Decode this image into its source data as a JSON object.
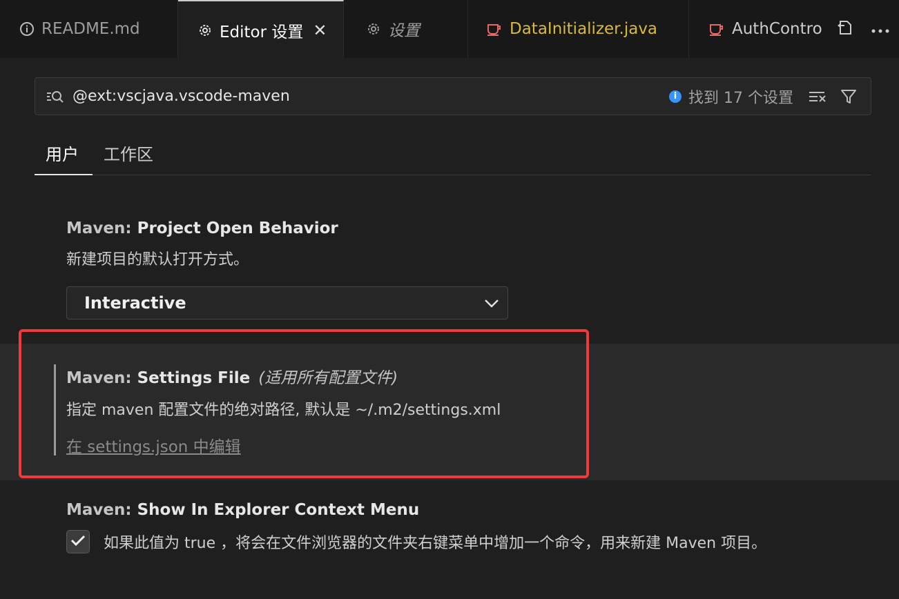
{
  "tabs": [
    {
      "label": "README.md",
      "icon": "info-icon"
    },
    {
      "label": "Editor 设置",
      "icon": "gear-icon",
      "close": "✕"
    },
    {
      "label": "设置",
      "icon": "gear-icon"
    },
    {
      "label": "DataInitializer.java",
      "icon": "java-icon"
    },
    {
      "label": "AuthContro",
      "icon": "java-icon"
    }
  ],
  "search": {
    "value": "@ext:vscjava.vscode-maven",
    "result_count": "找到 17 个设置"
  },
  "scope_tabs": [
    "用户",
    "工作区"
  ],
  "settings": [
    {
      "category": "Maven: ",
      "name": "Project Open Behavior",
      "description": "新建项目的默认打开方式。",
      "select_value": "Interactive"
    },
    {
      "category": "Maven: ",
      "name": "Settings File",
      "scope_note": "(适用所有配置文件)",
      "description": "指定 maven 配置文件的绝对路径, 默认是 ~/.m2/settings.xml",
      "link": "在 settings.json 中编辑"
    },
    {
      "category": "Maven: ",
      "name": "Show In Explorer Context Menu",
      "checked": true,
      "description": "如果此值为 true ，将会在文件浏览器的文件夹右键菜单中增加一个命令，用来新建 Maven 项目。"
    }
  ],
  "colors": {
    "highlight_border": "#f23a3a",
    "java_tab_text": "#d7ba3e",
    "java_icon": "#e46a6a",
    "info_badge": "#3794ff"
  }
}
